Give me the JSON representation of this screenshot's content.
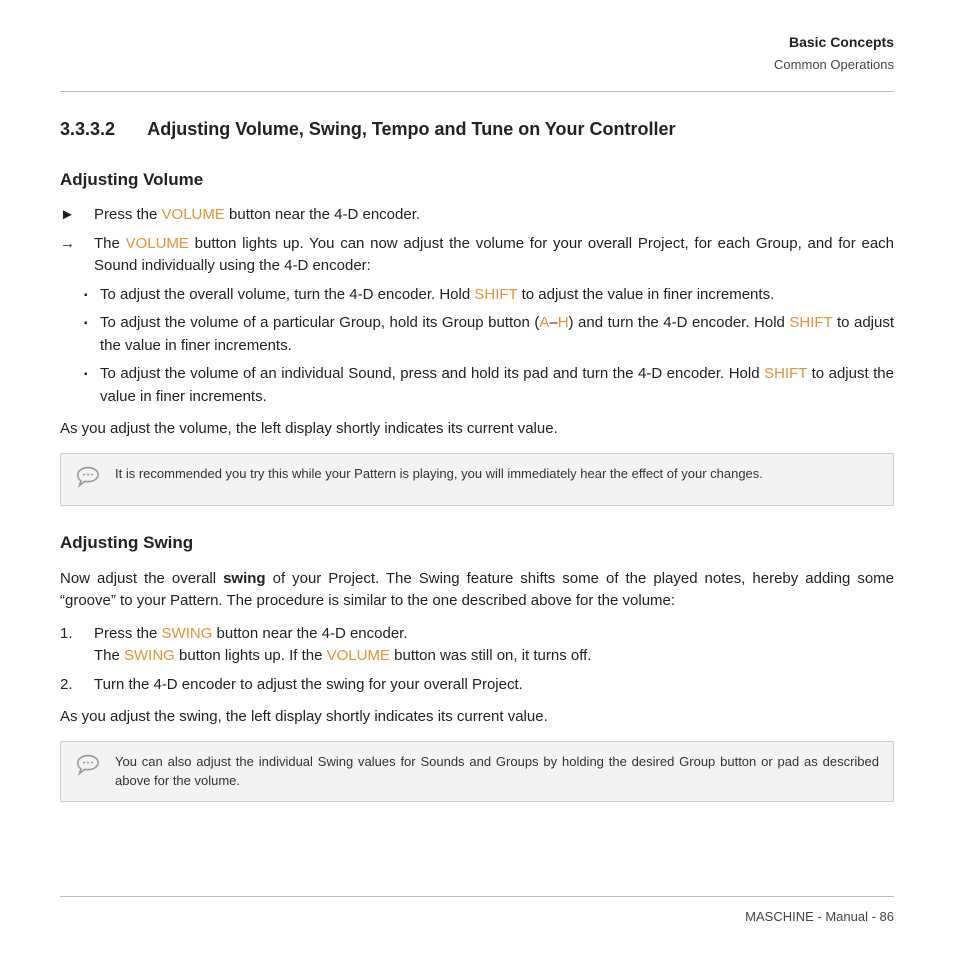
{
  "header": {
    "chapter": "Basic Concepts",
    "section": "Common Operations"
  },
  "section": {
    "number": "3.3.3.2",
    "title": "Adjusting Volume, Swing, Tempo and Tune on Your Controller"
  },
  "adjVol": {
    "heading": "Adjusting Volume",
    "step1_a": "Press the ",
    "step1_kw": "VOLUME",
    "step1_b": " button near the 4-D encoder.",
    "result_a": "The ",
    "result_kw": "VOLUME",
    "result_b": " button lights up. You can now adjust the volume for your overall Project, for each Group, and for each Sound individually using the 4-D encoder:",
    "b1_a": "To adjust the overall volume, turn the 4-D encoder. Hold ",
    "b1_kw": "SHIFT",
    "b1_b": " to adjust the value in finer increments.",
    "b2_a": "To adjust the volume of a particular Group, hold its Group button (",
    "b2_kw1": "A",
    "b2_dash": "–",
    "b2_kw2": "H",
    "b2_b": ") and turn the 4-D encoder. Hold ",
    "b2_kw3": "SHIFT",
    "b2_c": " to adjust the value in finer increments.",
    "b3_a": "To adjust the volume of an individual Sound, press and hold its pad and turn the 4-D encoder. Hold ",
    "b3_kw": "SHIFT",
    "b3_b": " to adjust the value in finer increments.",
    "post": "As you adjust the volume, the left display shortly indicates its current value.",
    "note": "It is recommended you try this while your Pattern is playing, you will immediately hear the effect of your changes."
  },
  "adjSwing": {
    "heading": "Adjusting Swing",
    "intro_a": "Now adjust the overall ",
    "intro_bold": "swing",
    "intro_b": " of your Project. The Swing feature shifts some of the played notes, hereby adding some “groove” to your Pattern. The procedure is similar to the one described above for the volume:",
    "s1_a": "Press the ",
    "s1_kw1": "SWING",
    "s1_b": " button near the 4-D encoder.",
    "s1_c": "The ",
    "s1_kw2": "SWING",
    "s1_d": " button lights up. If the ",
    "s1_kw3": "VOLUME",
    "s1_e": " button was still on, it turns off.",
    "s2": "Turn the 4-D encoder to adjust the swing for your overall Project.",
    "post": "As you adjust the swing, the left display shortly indicates its current value.",
    "note": "You can also adjust the individual Swing values for Sounds and Groups by holding the desired Group button or pad as described above for the volume."
  },
  "footer": {
    "text": "MASCHINE - Manual - 86"
  },
  "markers": {
    "tri": "►",
    "arrow": "→",
    "square": "▪",
    "o1": "1.",
    "o2": "2."
  }
}
